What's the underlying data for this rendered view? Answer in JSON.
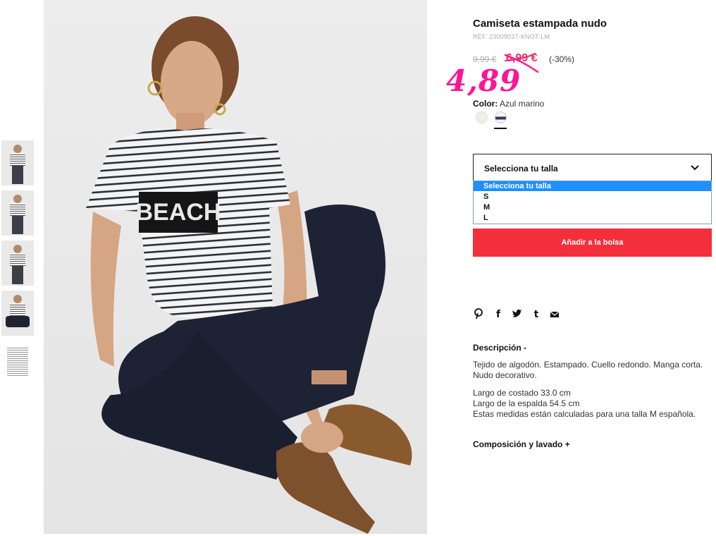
{
  "thumbnails": [
    {
      "kind": "standing-front"
    },
    {
      "kind": "standing-side"
    },
    {
      "kind": "standing-back"
    },
    {
      "kind": "sitting"
    },
    {
      "kind": "flat-lay"
    }
  ],
  "hero": {
    "shirt_text": "BEACH"
  },
  "product": {
    "title": "Camiseta estampada nudo",
    "ref": "REF. 23009037-KNOT-LM",
    "old_price": "9,99 €",
    "sale_price": "6,99 €",
    "discount": "(-30%)",
    "handwritten_price": "4,89",
    "handwritten_color": "#ff1493",
    "sale_color": "#e8334a"
  },
  "color": {
    "label": "Color:",
    "value": "Azul marino",
    "swatches": [
      {
        "name": "crudo",
        "hex": "#f1eee3"
      },
      {
        "name": "azul-marino-rayas",
        "hex": "#323a55",
        "selected": true
      }
    ]
  },
  "size_select": {
    "label": "Selecciona tu talla",
    "options": [
      "Selecciona tu talla",
      "S",
      "M",
      "L"
    ],
    "highlighted_index": 0
  },
  "add_button": {
    "label": "Añadir a la bolsa",
    "color": "#f42f3c"
  },
  "share_icons": [
    "pinterest-icon",
    "facebook-icon",
    "twitter-icon",
    "tumblr-icon",
    "email-icon"
  ],
  "description": {
    "heading": "Descripción -",
    "paragraph1": "Tejido de algodón. Estampado. Cuello redondo. Manga corta. Nudo decorativo.",
    "line1": "Largo de costado 33.0 cm",
    "line2": "Largo de la espalda 54.5 cm",
    "line3": "Estas medidas están calculadas para una talla M española."
  },
  "composition": {
    "heading": "Composición y lavado +"
  }
}
